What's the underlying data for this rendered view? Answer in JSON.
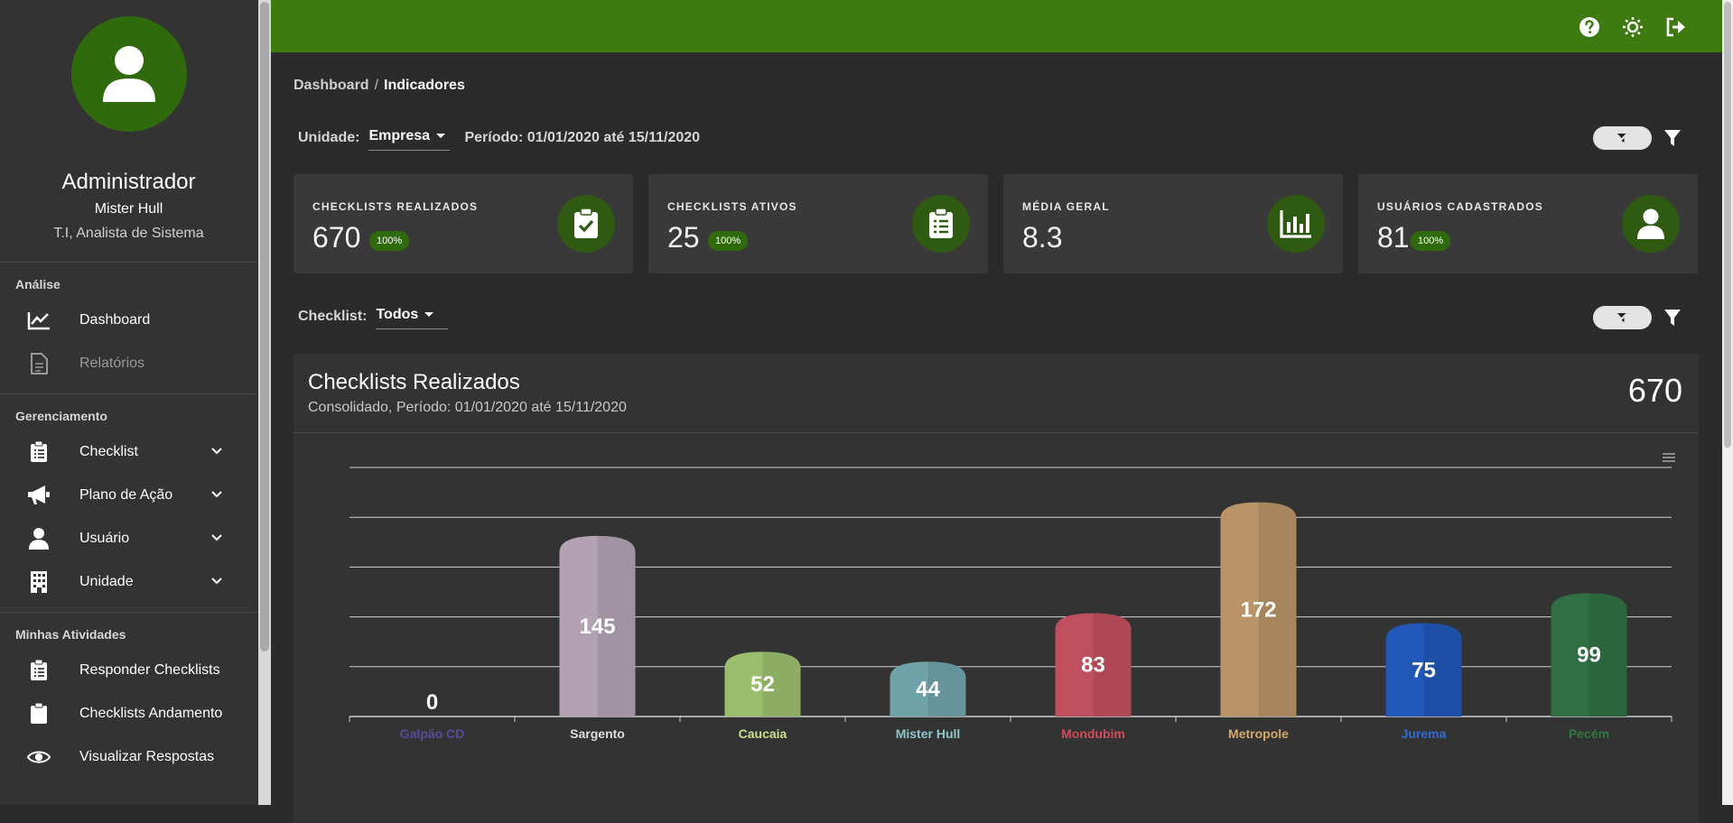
{
  "profile": {
    "name": "Administrador",
    "company": "Mister Hull",
    "role": "T.I, Analista de Sistema"
  },
  "sidebar": {
    "sections": [
      {
        "title": "Análise"
      },
      {
        "title": "Gerenciamento"
      },
      {
        "title": "Minhas Atividades"
      }
    ],
    "analise": [
      {
        "label": "Dashboard",
        "icon": "chart-line-icon"
      },
      {
        "label": "Relatórios",
        "icon": "file-icon"
      }
    ],
    "gerenciamento": [
      {
        "label": "Checklist",
        "icon": "clipboard-list-icon"
      },
      {
        "label": "Plano de Ação",
        "icon": "megaphone-icon"
      },
      {
        "label": "Usuário",
        "icon": "user-icon"
      },
      {
        "label": "Unidade",
        "icon": "building-icon"
      }
    ],
    "atividades": [
      {
        "label": "Responder Checklists",
        "icon": "clipboard-list-icon"
      },
      {
        "label": "Checklists Andamento",
        "icon": "clipboard-icon"
      },
      {
        "label": "Visualizar Respostas",
        "icon": "eye-icon"
      }
    ]
  },
  "breadcrumb": {
    "parent": "Dashboard",
    "separator": "/",
    "current": "Indicadores"
  },
  "filters": {
    "unidade_label": "Unidade:",
    "unidade_value": "Empresa",
    "periodo": "Período: 01/01/2020 até 15/11/2020",
    "checklist_label": "Checklist:",
    "checklist_value": "Todos"
  },
  "cards": [
    {
      "title": "CHECKLISTS REALIZADOS",
      "value": "670",
      "badge": "100%",
      "icon": "clipboard-check-icon"
    },
    {
      "title": "CHECKLISTS ATIVOS",
      "value": "25",
      "badge": "100%",
      "icon": "clipboard-list-icon"
    },
    {
      "title": "MÉDIA GERAL",
      "value": "8.3",
      "badge": "",
      "icon": "bar-chart-icon"
    },
    {
      "title": "USUÁRIOS CADASTRADOS",
      "value": "81",
      "badge": "100%",
      "icon": "user-icon"
    }
  ],
  "panel": {
    "title": "Checklists Realizados",
    "subtitle": "Consolidado, Período: 01/01/2020 até 15/11/2020",
    "total": "670"
  },
  "colors": {
    "brand_green": "#3d7a0f",
    "accent_green": "#2f6b0c"
  },
  "chart_data": {
    "type": "bar",
    "categories": [
      "Galpão CD",
      "Sargento",
      "Caucaia",
      "Mister Hull",
      "Mondubim",
      "Metropole",
      "Jurema",
      "Pecém"
    ],
    "values": [
      0,
      145,
      52,
      44,
      83,
      172,
      75,
      99
    ],
    "colors": [
      "#6a4fa8",
      "#b3a2b2",
      "#9bbd6e",
      "#6fa3aa",
      "#c0505e",
      "#b89468",
      "#2157b8",
      "#2f6f43"
    ],
    "label_colors": [
      "#5b49a0",
      "#dddddd",
      "#c9e08e",
      "#8fc6cc",
      "#d34b5a",
      "#d6a86a",
      "#2f6ad6",
      "#2d7a45"
    ],
    "ylim": [
      0,
      200
    ],
    "grid": true
  }
}
